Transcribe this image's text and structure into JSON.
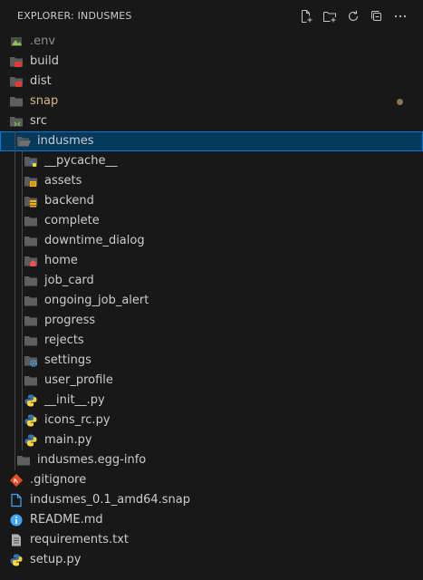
{
  "header": {
    "title": "EXPLORER: INDUSMES"
  },
  "actions": [
    {
      "name": "new-file-button",
      "icon": "new-file-icon"
    },
    {
      "name": "new-folder-button",
      "icon": "new-folder-icon"
    },
    {
      "name": "refresh-button",
      "icon": "refresh-icon"
    },
    {
      "name": "collapse-all-button",
      "icon": "collapse-all-icon"
    },
    {
      "name": "more-actions-button",
      "icon": "ellipsis-icon"
    }
  ],
  "tree": [
    {
      "label": ".env",
      "depth": 0,
      "icon": "env-icon",
      "state": "ignored"
    },
    {
      "label": "build",
      "depth": 0,
      "icon": "build-folder-icon"
    },
    {
      "label": "dist",
      "depth": 0,
      "icon": "dist-folder-icon"
    },
    {
      "label": "snap",
      "depth": 0,
      "icon": "folder-icon",
      "state": "modified"
    },
    {
      "label": "src",
      "depth": 0,
      "icon": "src-folder-icon"
    },
    {
      "label": "indusmes",
      "depth": 1,
      "icon": "folder-open-icon",
      "selected": true
    },
    {
      "label": "__pycache__",
      "depth": 2,
      "icon": "pycache-folder-icon"
    },
    {
      "label": "assets",
      "depth": 2,
      "icon": "assets-folder-icon"
    },
    {
      "label": "backend",
      "depth": 2,
      "icon": "backend-folder-icon"
    },
    {
      "label": "complete",
      "depth": 2,
      "icon": "folder-icon"
    },
    {
      "label": "downtime_dialog",
      "depth": 2,
      "icon": "folder-icon"
    },
    {
      "label": "home",
      "depth": 2,
      "icon": "home-folder-icon"
    },
    {
      "label": "job_card",
      "depth": 2,
      "icon": "folder-icon"
    },
    {
      "label": "ongoing_job_alert",
      "depth": 2,
      "icon": "folder-icon"
    },
    {
      "label": "progress",
      "depth": 2,
      "icon": "folder-icon"
    },
    {
      "label": "rejects",
      "depth": 2,
      "icon": "folder-icon"
    },
    {
      "label": "settings",
      "depth": 2,
      "icon": "settings-folder-icon"
    },
    {
      "label": "user_profile",
      "depth": 2,
      "icon": "folder-icon"
    },
    {
      "label": "__init__.py",
      "depth": 2,
      "icon": "python-icon"
    },
    {
      "label": "icons_rc.py",
      "depth": 2,
      "icon": "python-icon"
    },
    {
      "label": "main.py",
      "depth": 2,
      "icon": "python-icon"
    },
    {
      "label": "indusmes.egg-info",
      "depth": 1,
      "icon": "folder-icon"
    },
    {
      "label": ".gitignore",
      "depth": 0,
      "icon": "git-icon"
    },
    {
      "label": "indusmes_0.1_amd64.snap",
      "depth": 0,
      "icon": "file-icon"
    },
    {
      "label": "README.md",
      "depth": 0,
      "icon": "info-icon"
    },
    {
      "label": "requirements.txt",
      "depth": 0,
      "icon": "text-file-icon"
    },
    {
      "label": "setup.py",
      "depth": 0,
      "icon": "python-icon"
    }
  ],
  "colors": {
    "background": "#181818",
    "selection": "#04395e",
    "selection_border": "#0078d4",
    "modified": "#d7ba7d",
    "ignored": "#8c8c8c"
  }
}
